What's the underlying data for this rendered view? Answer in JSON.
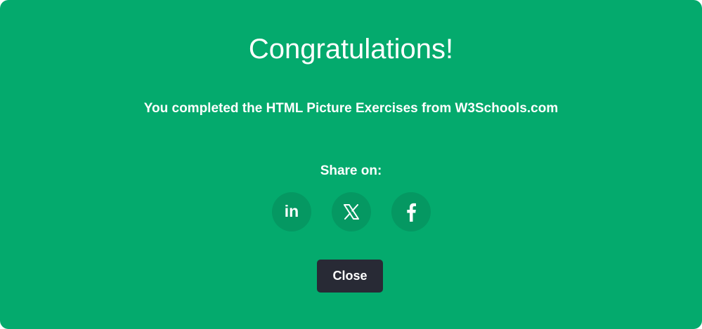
{
  "modal": {
    "title": "Congratulations!",
    "message": "You completed the HTML Picture Exercises from W3Schools.com",
    "share_label": "Share on:",
    "share_buttons": [
      {
        "icon": "linkedin-icon",
        "text": "in"
      },
      {
        "icon": "x-icon"
      },
      {
        "icon": "facebook-icon"
      }
    ],
    "close_label": "Close"
  },
  "colors": {
    "background": "#04AA6D",
    "share_button_bg": "#059862",
    "close_button_bg": "#282A35",
    "text": "#FFFFFF"
  }
}
